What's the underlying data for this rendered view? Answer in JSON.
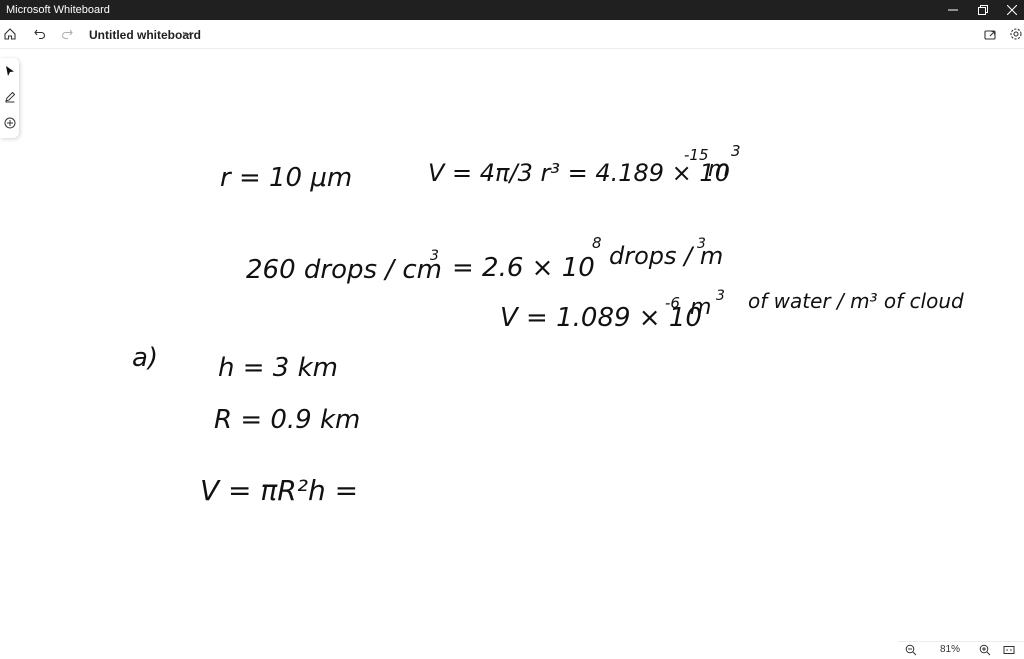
{
  "window": {
    "title": "Microsoft Whiteboard",
    "controls": [
      "minimize-icon",
      "restore-icon",
      "close-icon"
    ]
  },
  "toolbar": {
    "doc_title": "Untitled whiteboard",
    "icons": [
      "home-icon",
      "undo-icon",
      "redo-icon",
      "share-icon",
      "settings-icon"
    ]
  },
  "rail": {
    "tools": [
      "select-tool-icon",
      "pen-tool-icon",
      "add-icon"
    ]
  },
  "canvas": {
    "ink": {
      "line1_left": "r = 10 μm",
      "line1_right": "V = 4π/3 r³ = 4.189 × 10",
      "line1_exp": "-15",
      "line1_unit": "m",
      "line1_unit_exp": "3",
      "line2_left": "260  drops / cm",
      "line2_left_exp": "3",
      "line2_mid": "= 2.6 × 10",
      "line2_mid_exp": "8",
      "line2_right": "drops / m",
      "line2_right_exp": "3",
      "line3": "V = 1.089 × 10",
      "line3_exp": "-6",
      "line3_unit": "m",
      "line3_unit_exp": "3",
      "line3_tail": "of water / m³ of cloud",
      "part_label": "a)",
      "h_line": "h = 3 km",
      "R_line": "R = 0.9 km",
      "V_line": "V = πR²h ="
    }
  },
  "zoom": {
    "level": "81%"
  }
}
